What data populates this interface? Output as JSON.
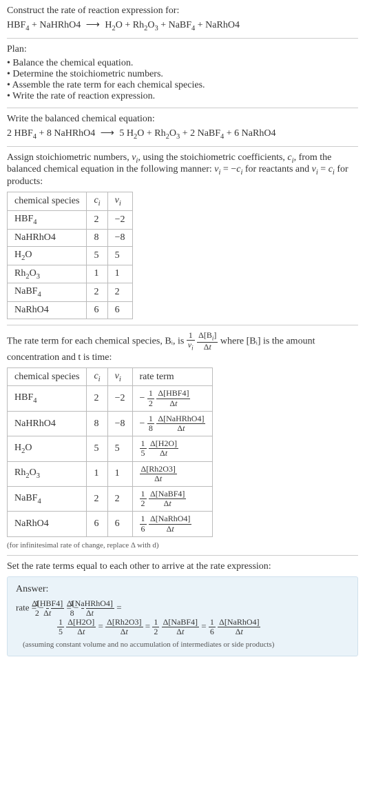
{
  "title": "Construct the rate of reaction expression for:",
  "unbalanced_eq": "HBF₄ + NaHRhO4 ⟶ H₂O + Rh₂O₃ + NaBF₄ + NaRhO4",
  "plan_label": "Plan:",
  "plan_items": [
    "Balance the chemical equation.",
    "Determine the stoichiometric numbers.",
    "Assemble the rate term for each chemical species.",
    "Write the rate of reaction expression."
  ],
  "balanced_label": "Write the balanced chemical equation:",
  "balanced_eq": "2 HBF₄ + 8 NaHRhO4 ⟶ 5 H₂O + Rh₂O₃ + 2 NaBF₄ + 6 NaRhO4",
  "stoich_text": "Assign stoichiometric numbers, νᵢ, using the stoichiometric coefficients, cᵢ, from the balanced chemical equation in the following manner: νᵢ = −cᵢ for reactants and νᵢ = cᵢ for products:",
  "table1": {
    "headers": [
      "chemical species",
      "cᵢ",
      "νᵢ"
    ],
    "rows": [
      [
        "HBF₄",
        "2",
        "−2"
      ],
      [
        "NaHRhO4",
        "8",
        "−8"
      ],
      [
        "H₂O",
        "5",
        "5"
      ],
      [
        "Rh₂O₃",
        "1",
        "1"
      ],
      [
        "NaBF₄",
        "2",
        "2"
      ],
      [
        "NaRhO4",
        "6",
        "6"
      ]
    ]
  },
  "rate_term_text_pre": "The rate term for each chemical species, Bᵢ, is ",
  "rate_term_text_post": " where [Bᵢ] is the amount concentration and t is time:",
  "table2": {
    "headers": [
      "chemical species",
      "cᵢ",
      "νᵢ",
      "rate term"
    ],
    "rows": [
      {
        "sp": "HBF₄",
        "c": "2",
        "v": "−2",
        "sign": "−",
        "fn": "1",
        "fd": "2",
        "num": "Δ[HBF4]"
      },
      {
        "sp": "NaHRhO4",
        "c": "8",
        "v": "−8",
        "sign": "−",
        "fn": "1",
        "fd": "8",
        "num": "Δ[NaHRhO4]"
      },
      {
        "sp": "H₂O",
        "c": "5",
        "v": "5",
        "sign": "",
        "fn": "1",
        "fd": "5",
        "num": "Δ[H2O]"
      },
      {
        "sp": "Rh₂O₃",
        "c": "1",
        "v": "1",
        "sign": "",
        "fn": "",
        "fd": "",
        "num": "Δ[Rh2O3]"
      },
      {
        "sp": "NaBF₄",
        "c": "2",
        "v": "2",
        "sign": "",
        "fn": "1",
        "fd": "2",
        "num": "Δ[NaBF4]"
      },
      {
        "sp": "NaRhO4",
        "c": "6",
        "v": "6",
        "sign": "",
        "fn": "1",
        "fd": "6",
        "num": "Δ[NaRhO4]"
      }
    ]
  },
  "infinitesimal_note": "(for infinitesimal rate of change, replace Δ with d)",
  "final_text": "Set the rate terms equal to each other to arrive at the rate expression:",
  "answer_label": "Answer:",
  "answer": {
    "terms": [
      {
        "sign": "−",
        "fn": "1",
        "fd": "2",
        "num": "Δ[HBF4]"
      },
      {
        "sign": "−",
        "fn": "1",
        "fd": "8",
        "num": "Δ[NaHRhO4]"
      },
      {
        "sign": "",
        "fn": "1",
        "fd": "5",
        "num": "Δ[H2O]"
      },
      {
        "sign": "",
        "fn": "",
        "fd": "",
        "num": "Δ[Rh2O3]"
      },
      {
        "sign": "",
        "fn": "1",
        "fd": "2",
        "num": "Δ[NaBF4]"
      },
      {
        "sign": "",
        "fn": "1",
        "fd": "6",
        "num": "Δ[NaRhO4]"
      }
    ]
  },
  "answer_note": "(assuming constant volume and no accumulation of intermediates or side products)",
  "delta_t": "Δt",
  "rate_prefix": "rate = "
}
